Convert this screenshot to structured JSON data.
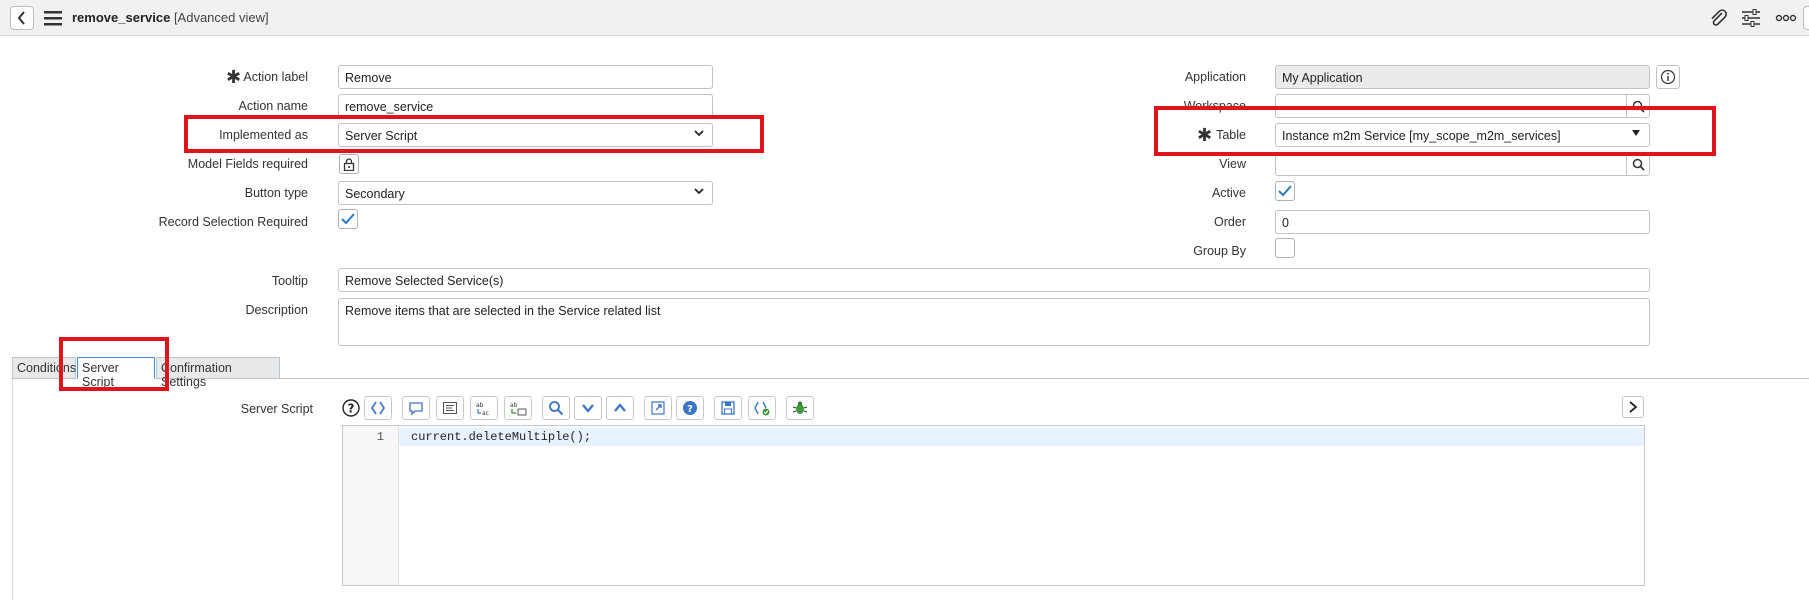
{
  "header": {
    "record_name": "remove_service",
    "view_label": "[Advanced view]",
    "icons": [
      "back-icon",
      "hamburger-icon",
      "attachment-icon",
      "settings-sliders-icon",
      "more-icon"
    ]
  },
  "form": {
    "action_label": {
      "label": "Action label",
      "value": "Remove"
    },
    "action_name": {
      "label": "Action name",
      "value": "remove_service"
    },
    "implemented_as": {
      "label": "Implemented as",
      "value": "Server Script"
    },
    "model_fields_required": {
      "label": "Model Fields required"
    },
    "button_type": {
      "label": "Button type",
      "value": "Secondary"
    },
    "record_selection_required": {
      "label": "Record Selection Required",
      "checked": true
    },
    "application": {
      "label": "Application",
      "value": "My Application"
    },
    "workspace": {
      "label": "Workspace",
      "value": ""
    },
    "table": {
      "label": "Table",
      "value": "Instance m2m Service [my_scope_m2m_services]"
    },
    "view": {
      "label": "View",
      "value": ""
    },
    "active": {
      "label": "Active",
      "checked": true
    },
    "order": {
      "label": "Order",
      "value": "0"
    },
    "group_by": {
      "label": "Group By",
      "checked": false
    },
    "tooltip": {
      "label": "Tooltip",
      "value": "Remove Selected Service(s)"
    },
    "description": {
      "label": "Description",
      "value": "Remove items that are selected in the Service related list"
    }
  },
  "tabs": [
    {
      "label": "Conditions",
      "active": false
    },
    {
      "label": "Server Script",
      "active": true
    },
    {
      "label": "Confirmation Settings",
      "active": false
    }
  ],
  "script": {
    "label": "Server Script",
    "line_number": "1",
    "code": "current.deleteMultiple();"
  },
  "colors": {
    "highlight": "#e0151c",
    "accent": "#4a8ad6",
    "header_bg": "#eff1f3"
  }
}
